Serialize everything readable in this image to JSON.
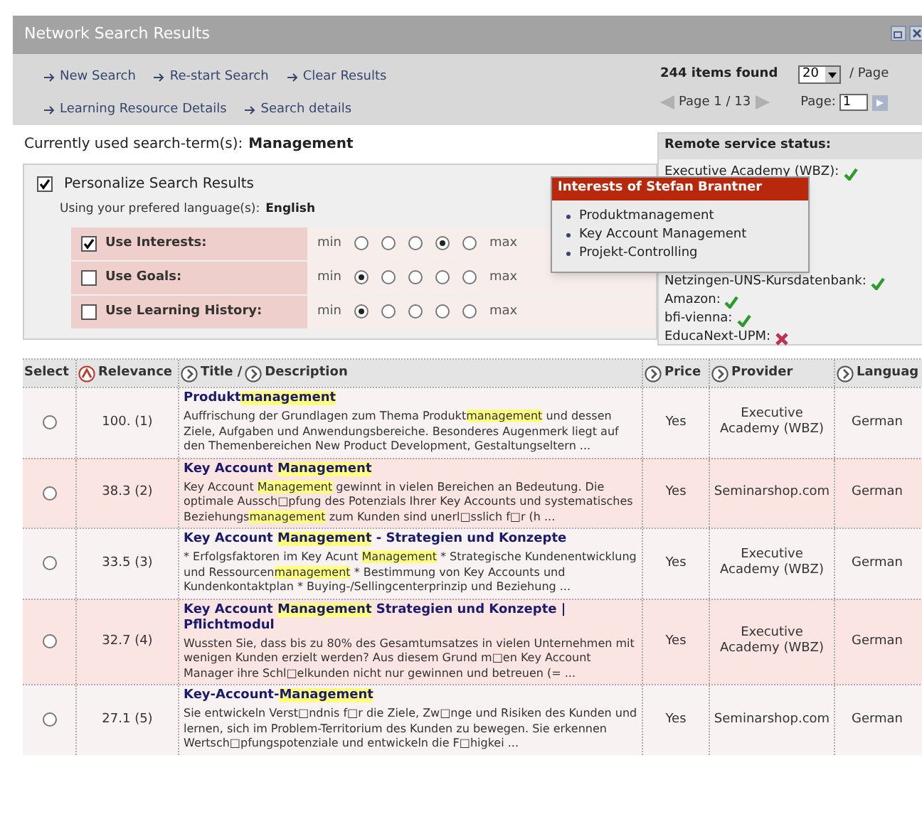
{
  "window": {
    "title": "Network Search Results"
  },
  "toolbar": {
    "links": [
      [
        "New Search",
        "Re-start Search",
        "Clear Results"
      ],
      [
        "Learning Resource Details",
        "Search details"
      ]
    ],
    "items_found": "244 items found",
    "per_page": "20",
    "per_page_label": "/ Page",
    "page_info": "Page 1 / 13",
    "page_label": "Page:",
    "page_value": "1"
  },
  "search_term": {
    "label": "Currently used search-term(s):",
    "value": "Management"
  },
  "personalize": {
    "label": "Personalize Search Results",
    "checked": true,
    "language_label": "Using your prefered language(s):",
    "language": "English",
    "factors": [
      {
        "label": "Use Interests:",
        "checked": true,
        "min_label": "min",
        "max_label": "max",
        "options": [
          {
            "selected": false
          },
          {
            "selected": false
          },
          {
            "selected": false
          },
          {
            "selected": true
          },
          {
            "selected": false
          }
        ]
      },
      {
        "label": "Use Goals:",
        "checked": false,
        "min_label": "min",
        "max_label": "max",
        "options": [
          {
            "selected": true
          },
          {
            "selected": false
          },
          {
            "selected": false
          },
          {
            "selected": false
          },
          {
            "selected": false
          }
        ]
      },
      {
        "label": "Use Learning History:",
        "checked": false,
        "min_label": "min",
        "max_label": "max",
        "options": [
          {
            "selected": true
          },
          {
            "selected": false
          },
          {
            "selected": false
          },
          {
            "selected": false
          },
          {
            "selected": false
          }
        ]
      }
    ]
  },
  "remote_status": {
    "title": "Remote service status:",
    "services": [
      {
        "name": "Executive Academy (WBZ):",
        "ok": true
      },
      {
        "name": "Netzingen-UNS-Kursdatenbank:",
        "ok": true
      },
      {
        "name": "Amazon:",
        "ok": true
      },
      {
        "name": "bfi-vienna:",
        "ok": true
      },
      {
        "name": "EducaNext-UPM:",
        "ok": false
      }
    ]
  },
  "interests_popup": {
    "title": "Interests of Stefan Brantner",
    "items": [
      "Produktmanagement",
      "Key Account Management",
      "Projekt-Controlling"
    ]
  },
  "table": {
    "columns": [
      {
        "headers": [
          {
            "text": "Select"
          }
        ]
      },
      {
        "headers": [
          {
            "text": "Relevance",
            "sorted": true
          }
        ]
      },
      {
        "headers": [
          {
            "text": "Title /",
            "sorted": false
          },
          {
            "text": "Description",
            "sorted": false
          }
        ]
      },
      {
        "headers": [
          {
            "text": "Price",
            "sorted": false
          }
        ]
      },
      {
        "headers": [
          {
            "text": "Provider",
            "sorted": false
          }
        ]
      },
      {
        "headers": [
          {
            "text": "Languag",
            "sorted": false
          }
        ]
      }
    ],
    "rows": [
      {
        "selected": false,
        "relevance": "100. (1)",
        "title": [
          {
            "text": "Produkt",
            "highlight": false
          },
          {
            "text": "management",
            "highlight": true
          }
        ],
        "description": [
          {
            "text": "Auffrischung der Grundlagen zum Thema Produkt",
            "highlight": false
          },
          {
            "text": "management",
            "highlight": true
          },
          {
            "text": " und dessen Ziele, Aufgaben und Anwendungsbereiche. Besonderes Augenmerk liegt auf den Themenbereichen New Product Development, Gestaltungseltern ...",
            "highlight": false
          }
        ],
        "price": "Yes",
        "provider": "Executive Academy (WBZ)",
        "language": "German"
      },
      {
        "selected": false,
        "relevance": "38.3 (2)",
        "title": [
          {
            "text": "Key Account ",
            "highlight": false
          },
          {
            "text": "Management",
            "highlight": true
          }
        ],
        "description": [
          {
            "text": "Key Account ",
            "highlight": false
          },
          {
            "text": "Management",
            "highlight": true
          },
          {
            "text": " gewinnt in vielen Bereichen an Bedeutung. Die optimale Aussch□pfung des Potenzials Ihrer Key Accounts und systematisches Beziehungs",
            "highlight": false
          },
          {
            "text": "management",
            "highlight": true
          },
          {
            "text": " zum Kunden sind unerl□sslich f□r (h ...",
            "highlight": false
          }
        ],
        "price": "Yes",
        "provider": "Seminarshop.com",
        "language": "German"
      },
      {
        "selected": false,
        "relevance": "33.5 (3)",
        "title": [
          {
            "text": "Key Account ",
            "highlight": false
          },
          {
            "text": "Management",
            "highlight": true
          },
          {
            "text": " - Strategien und Konzepte",
            "highlight": false
          }
        ],
        "description": [
          {
            "text": "* Erfolgsfaktoren im Key Acunt ",
            "highlight": false
          },
          {
            "text": "Management",
            "highlight": true
          },
          {
            "text": " * Strategische Kundenentwicklung und Ressourcen",
            "highlight": false
          },
          {
            "text": "management",
            "highlight": true
          },
          {
            "text": " * Bestimmung von Key Accounts und Kundenkontaktplan * Buying-/Sellingcenterprinzip und Beziehung ...",
            "highlight": false
          }
        ],
        "price": "Yes",
        "provider": "Executive Academy (WBZ)",
        "language": "German"
      },
      {
        "selected": false,
        "relevance": "32.7 (4)",
        "title": [
          {
            "text": "Key Account ",
            "highlight": false
          },
          {
            "text": "Management",
            "highlight": true
          },
          {
            "text": " Strategien und Konzepte | Pflichtmodul",
            "highlight": false
          }
        ],
        "description": [
          {
            "text": "Wussten Sie, dass bis zu 80% des Gesamtumsatzes in vielen Unternehmen mit wenigen Kunden erzielt werden? Aus diesem Grund m□en Key Account Manager ihre Schl□elkunden nicht nur gewinnen und betreuen (= ...",
            "highlight": false
          }
        ],
        "price": "Yes",
        "provider": "Executive Academy (WBZ)",
        "language": "German"
      },
      {
        "selected": false,
        "relevance": "27.1 (5)",
        "title": [
          {
            "text": "Key-Account-",
            "highlight": false
          },
          {
            "text": "Management",
            "highlight": true
          }
        ],
        "description": [
          {
            "text": "Sie entwickeln Verst□ndnis f□r die Ziele, Zw□nge und Risiken des Kunden und lernen, sich im Problem-Territorium des Kunden zu bewegen. Sie erkennen Wertsch□pfungspotenziale und entwickeln die F□higkei ...",
            "highlight": false
          }
        ],
        "price": "Yes",
        "provider": "Seminarshop.com",
        "language": "German"
      }
    ]
  }
}
